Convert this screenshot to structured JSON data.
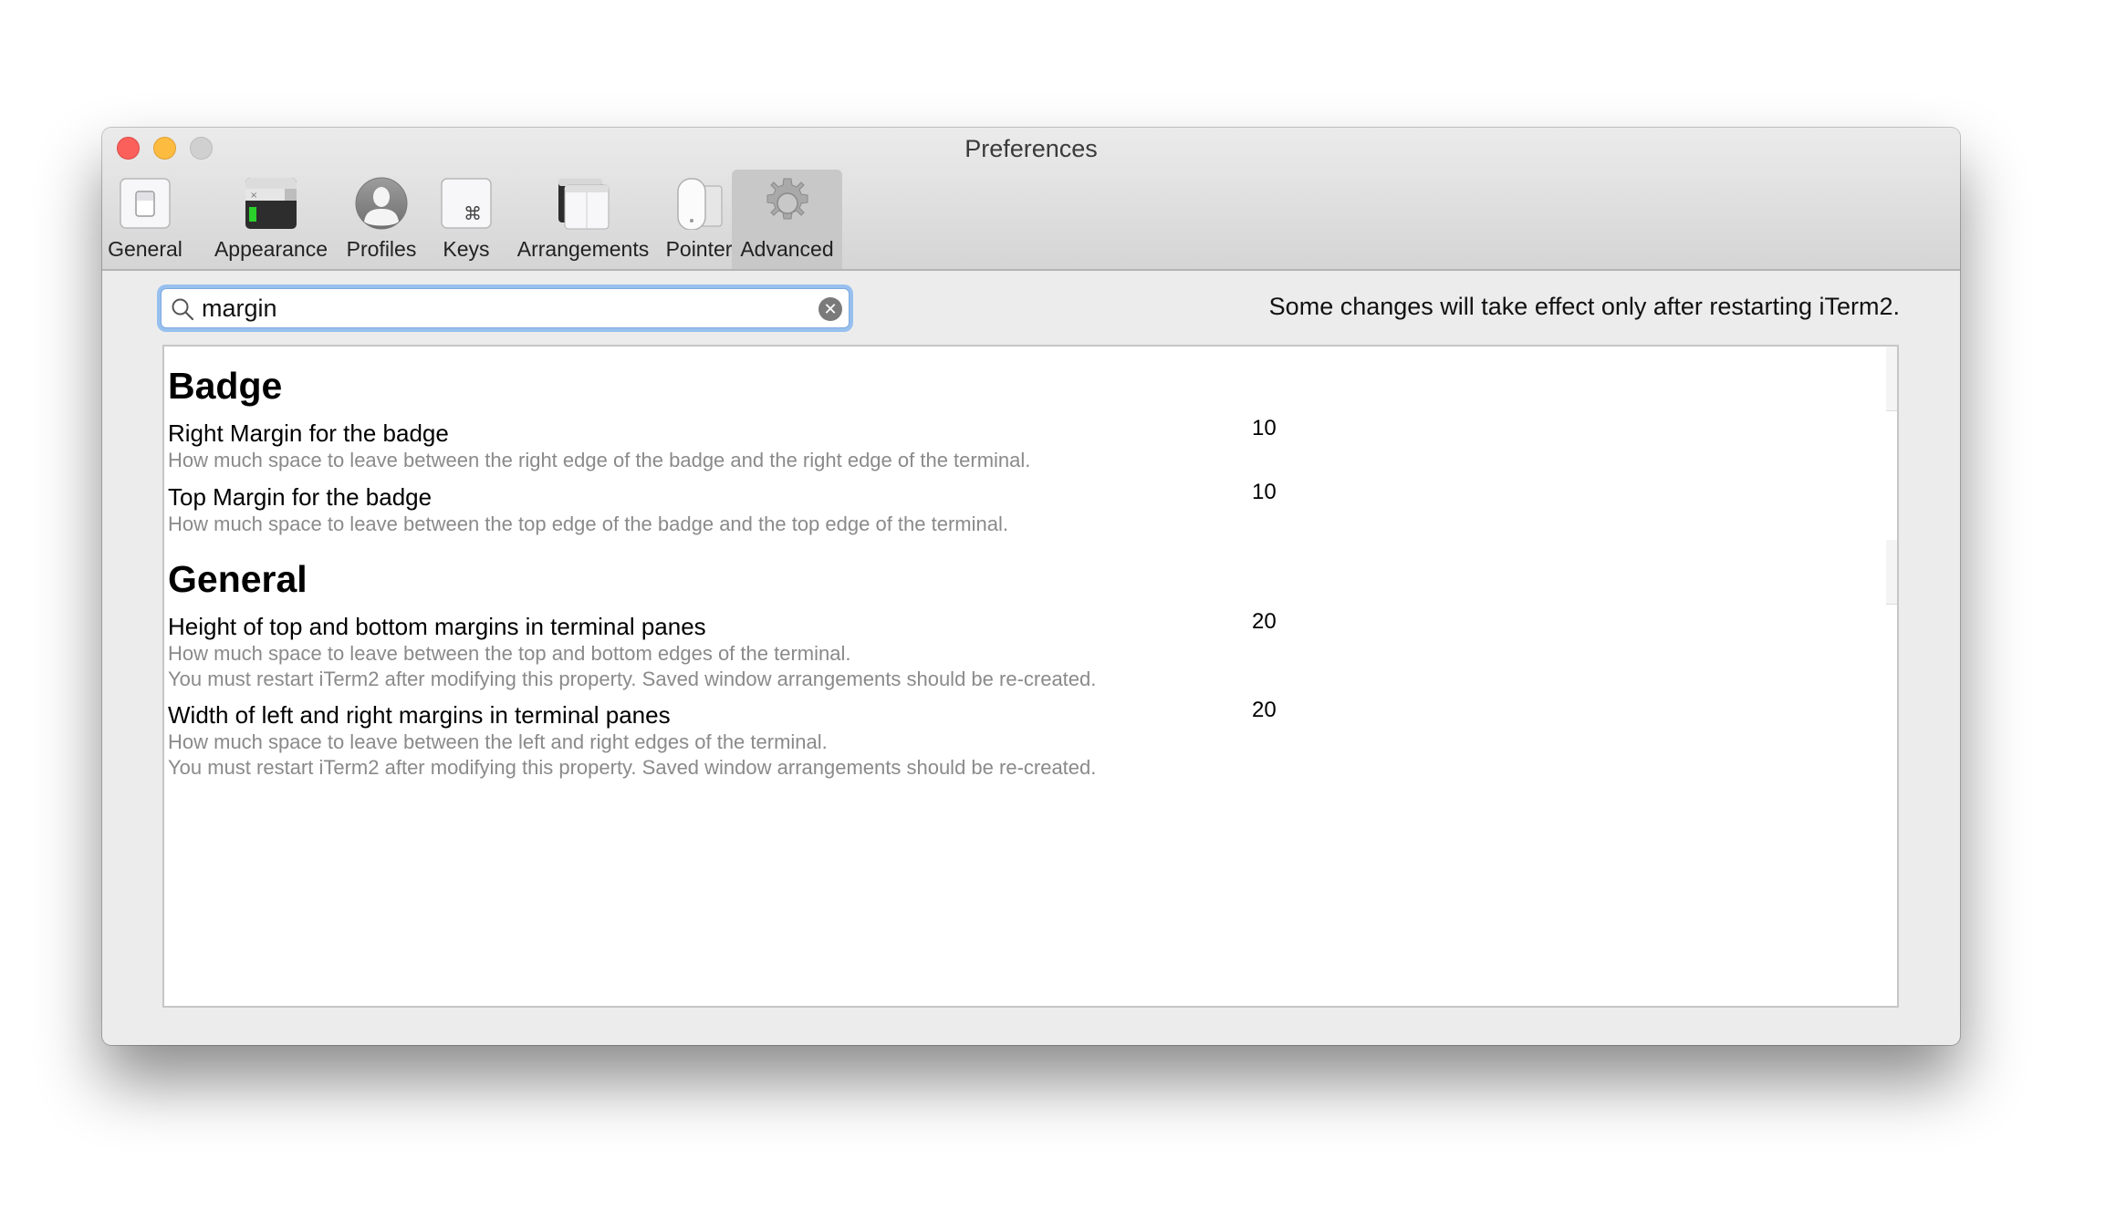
{
  "window": {
    "title": "Preferences",
    "traffic_lights": {
      "close": "close-button",
      "minimize": "minimize-button",
      "zoom": "zoom-button"
    }
  },
  "toolbar": {
    "tabs": [
      {
        "label": "General",
        "icon": "switch-icon",
        "selected": false
      },
      {
        "label": "Appearance",
        "icon": "terminal-window-icon",
        "selected": false
      },
      {
        "label": "Profiles",
        "icon": "person-silhouette-icon",
        "selected": false
      },
      {
        "label": "Keys",
        "icon": "command-key-icon",
        "selected": false
      },
      {
        "label": "Arrangements",
        "icon": "stacked-windows-icon",
        "selected": false
      },
      {
        "label": "Pointer",
        "icon": "mouse-icon",
        "selected": false
      },
      {
        "label": "Advanced",
        "icon": "gear-icon",
        "selected": true
      }
    ]
  },
  "search": {
    "value": "margin",
    "placeholder": "",
    "icon": "magnifier-icon",
    "clear_icon": "clear-icon",
    "clear_glyph": "✕"
  },
  "notice": "Some changes will take effect only after restarting iTerm2.",
  "sections": [
    {
      "title": "Badge",
      "rows": [
        {
          "title": "Right Margin for the badge",
          "description": [
            "How much space to leave between the right edge of the badge and the right edge of the terminal."
          ],
          "value": "10"
        },
        {
          "title": "Top Margin for the badge",
          "description": [
            "How much space to leave between the top edge of the badge and the top edge of the terminal."
          ],
          "value": "10"
        }
      ]
    },
    {
      "title": "General",
      "rows": [
        {
          "title": "Height of top and bottom margins in terminal panes",
          "description": [
            "How much space to leave between the top and bottom edges of the terminal.",
            "You must restart iTerm2 after modifying this property. Saved window arrangements should be re-created."
          ],
          "value": "20"
        },
        {
          "title": "Width of left and right margins in terminal panes",
          "description": [
            "How much space to leave between the left and right edges of the terminal.",
            "You must restart iTerm2 after modifying this property. Saved window arrangements should be re-created."
          ],
          "value": "20"
        }
      ]
    }
  ]
}
